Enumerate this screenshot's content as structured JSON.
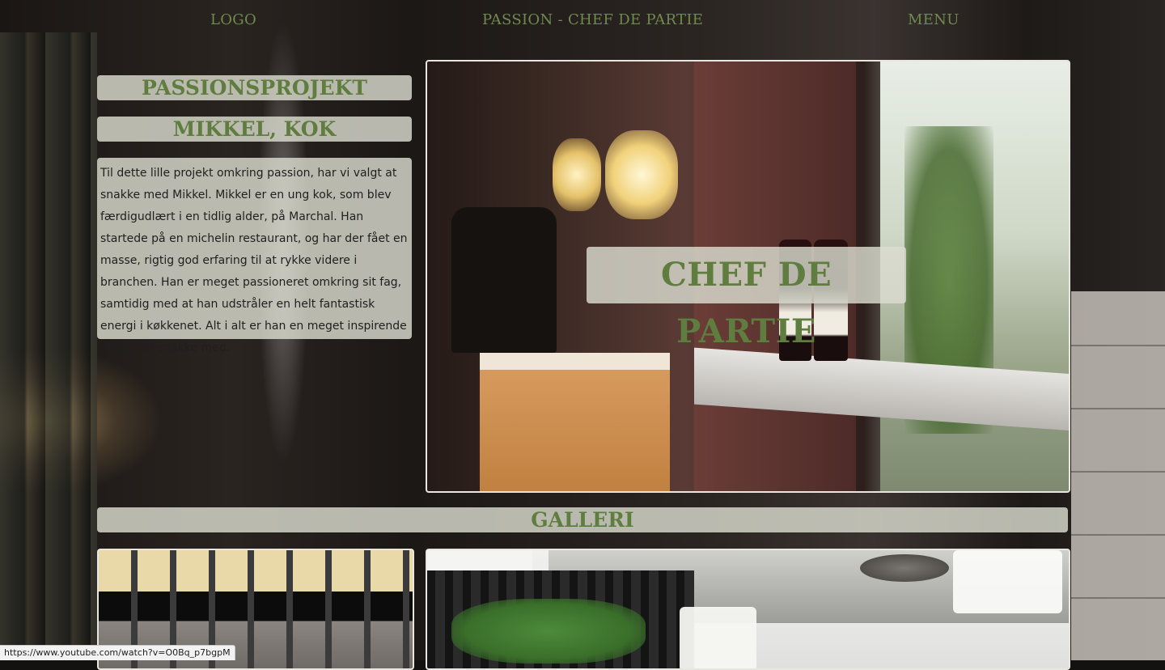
{
  "nav": {
    "logo": "LOGO",
    "title": "PASSION - CHEF DE PARTIE",
    "menu": "MENU"
  },
  "sidebar": {
    "heading_1": "PASSIONSPROJEKT",
    "heading_2": "MIKKEL, KOK",
    "intro_text": "Til dette lille projekt omkring passion, har vi valgt at snakke med Mikkel. Mikkel er en ung kok, som blev færdigudlært i en tidlig alder, på Marchal. Han startede på en michelin restaurant, og har der fået en masse, rigtig god erfaring til at rykke videre i branchen. Han er meget passioneret omkring sit fag, samtidig med at han udstråler en helt fantastisk energi i køkkenet. Alt i alt er han en meget inspirende person at snakke med."
  },
  "hero": {
    "title": "CHEF DE PARTIE"
  },
  "gallery": {
    "heading": "GALLERI"
  },
  "status": {
    "link_url": "https://www.youtube.com/watch?v=O0Bq_p7bgpM"
  },
  "colors": {
    "accent_green": "#5f7d3e",
    "label_bg": "#dadcd0"
  }
}
